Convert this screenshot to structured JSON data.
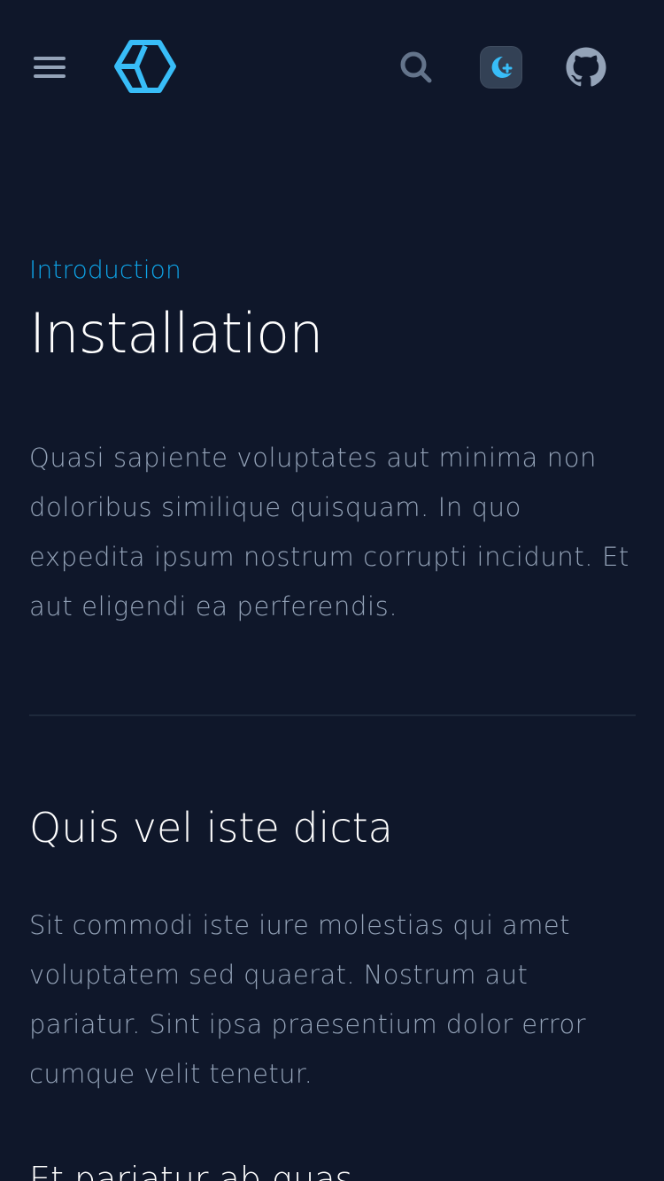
{
  "header": {
    "menu_icon": "hamburger-menu-icon",
    "logo_icon": "hexagon-logo-icon",
    "search_icon": "search-icon",
    "theme_icon": "moon-theme-icon",
    "github_icon": "github-icon",
    "accent_color": "#38bdf8"
  },
  "article": {
    "section": "Introduction",
    "title": "Installation",
    "lead": "Quasi sapiente voluptates aut minima non doloribus similique quisquam. In quo expedita ipsum nostrum corrupti incidunt. Et aut eligendi ea perferendis.",
    "heading": "Quis vel iste dicta",
    "paragraph": "Sit commodi iste iure molestias qui amet voluptatem sed quaerat. Nostrum aut pariatur. Sint ipsa praesentium dolor error cumque velit tenetur.",
    "subheading": "Et pariatur ab quas"
  },
  "colors": {
    "background": "#0f172a",
    "eyebrow": "#0ea5e9",
    "body_text": "#94a3b8",
    "heading_text": "#ffffff"
  }
}
